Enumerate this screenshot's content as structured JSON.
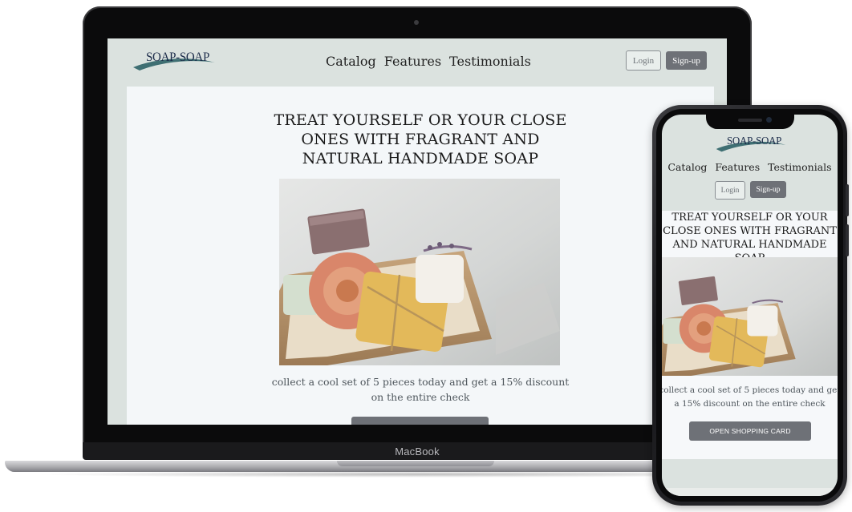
{
  "brand": {
    "logo_text": "SOAP-SOAP"
  },
  "nav": {
    "items": [
      "Catalog",
      "Features",
      "Testimonials"
    ]
  },
  "auth": {
    "login_label": "Login",
    "signup_label": "Sign-up"
  },
  "hero": {
    "title_lines": [
      "TREAT YOURSELF OR YOUR CLOSE",
      "ONES WITH FRAGRANT AND",
      "NATURAL HANDMADE SOAP"
    ],
    "phone_title_lines": [
      "TREAT YOURSELF OR YOUR",
      "CLOSE ONES WITH FRAGRANT",
      "AND NATURAL HANDMADE SOAP"
    ],
    "text_lines": [
      "collect a cool set of 5 pieces today and get a 15% discount",
      "on the entire check"
    ],
    "phone_text_lines": [
      "collect a cool set of 5 pieces today and get",
      "a 15% discount on the entire check"
    ],
    "cta_label": "OPEN SHOPPING CARD"
  },
  "device": {
    "laptop_label": "MacBook"
  },
  "colors": {
    "header_bg": "#dbe2df",
    "content_bg": "#f4f7f9",
    "button_dark": "#6e7177",
    "logo_text": "#1c2c4a",
    "logo_swoosh": "#3f6f73"
  }
}
